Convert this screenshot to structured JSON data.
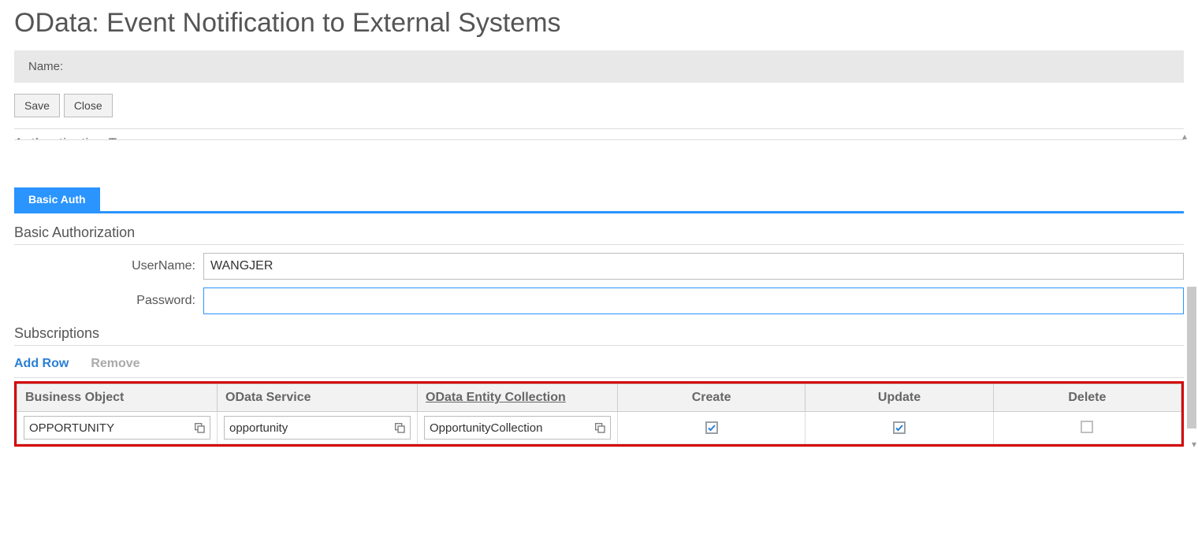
{
  "page": {
    "title": "OData: Event Notification to External Systems"
  },
  "name_bar": {
    "label": "Name:"
  },
  "toolbar": {
    "save_label": "Save",
    "close_label": "Close"
  },
  "cutoff_heading": "Authentication Type",
  "tabs": {
    "basic_auth": "Basic Auth"
  },
  "auth": {
    "heading": "Basic Authorization",
    "username_label": "UserName:",
    "username_value": "WANGJER",
    "password_label": "Password:",
    "password_value": ""
  },
  "subs": {
    "heading": "Subscriptions",
    "add_row_label": "Add Row",
    "remove_label": "Remove",
    "columns": {
      "business_object": "Business Object",
      "odata_service": "OData Service",
      "odata_entity": "OData Entity Collection",
      "create": "Create",
      "update": "Update",
      "delete": "Delete"
    },
    "rows": [
      {
        "business_object": "OPPORTUNITY",
        "odata_service": "opportunity",
        "odata_entity": "OpportunityCollection",
        "create": true,
        "update": true,
        "delete": false
      }
    ]
  }
}
